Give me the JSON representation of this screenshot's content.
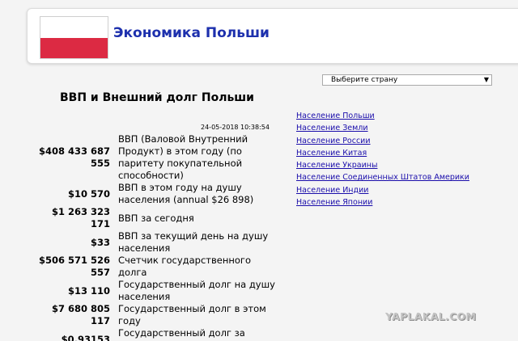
{
  "header": {
    "title": "Экономика Польши",
    "flag_colors": [
      "#ffffff",
      "#dc2a43"
    ]
  },
  "country_select": {
    "value": "Выберите страну"
  },
  "heading": "ВВП и Внешний долг Польши",
  "timestamp": "24-05-2018 10:38:54",
  "stats": [
    {
      "value": "$408 433 687 555",
      "label": "ВВП (Валовой Внутренний Продукт) в этом году (по паритету покупательной способности)"
    },
    {
      "value": "$10 570",
      "label": "ВВП в этом году на душу населения (annual $26 898)"
    },
    {
      "value": "$1 263 323 171",
      "label": "ВВП за сегодня"
    },
    {
      "value": "$33",
      "label": "ВВП за текущий день на душу населения"
    },
    {
      "value": "$506 571 526 557",
      "label": "Счетчик государственного долга"
    },
    {
      "value": "$13 110",
      "label": "Государственный долг на душу населения"
    },
    {
      "value": "$7 680 805 117",
      "label": "Государственный долг в этом году"
    },
    {
      "value": "$0.93153",
      "label": "Государственный долг за сегодня"
    }
  ],
  "links": [
    "Население Польши",
    "Население Земли",
    "Население России",
    "Население Китая",
    "Население Украины",
    "Население Соединенных Штатов Америки",
    "Население Индии",
    "Население Японии"
  ],
  "watermark": "YAPLAKAL.COM"
}
